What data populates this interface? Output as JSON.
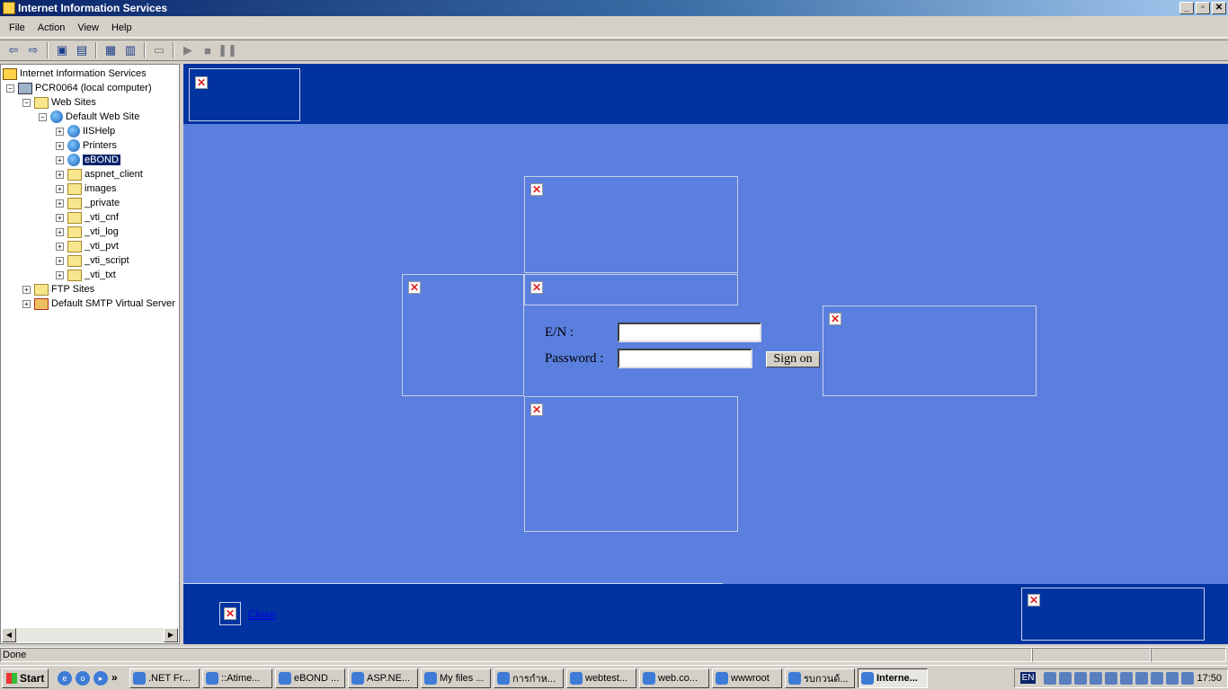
{
  "window": {
    "title": "Internet Information Services",
    "min": "_",
    "restore": "▫",
    "close": "✕"
  },
  "menu": [
    "File",
    "Action",
    "View",
    "Help"
  ],
  "toolbar": {
    "buttons": [
      "back-icon",
      "forward-icon",
      "up-icon",
      "show-hide-tree-icon",
      "properties-icon",
      "export-icon",
      "computer-icon",
      "play-icon",
      "stop-icon",
      "pause-icon"
    ]
  },
  "tree": {
    "root": "Internet Information Services",
    "computer": "PCR0064 (local computer)",
    "web_sites": "Web Sites",
    "default_web_site": "Default Web Site",
    "children": [
      "IISHelp",
      "Printers",
      "eBOND",
      "aspnet_client",
      "images",
      "_private",
      "_vti_cnf",
      "_vti_log",
      "_vti_pvt",
      "_vti_script",
      "_vti_txt"
    ],
    "ftp_sites": "FTP Sites",
    "smtp": "Default SMTP Virtual Server",
    "selected": "eBOND"
  },
  "page": {
    "en_label": "E/N :",
    "password_label": "Password :",
    "en_value": "",
    "password_value": "",
    "signon": "Sign on",
    "close_link": "Close",
    "broken_image": "✕"
  },
  "status": {
    "text": "Done"
  },
  "taskbar": {
    "start": "Start",
    "chevron": "»",
    "tasks": [
      ".NET Fr...",
      "::Atime...",
      "eBOND ...",
      "ASP.NE...",
      "My files ...",
      "การกำห...",
      "webtest...",
      "web.co...",
      "wwwroot",
      "รบกวนด้...",
      "Interne..."
    ],
    "lang": "EN",
    "clock": "17:50"
  },
  "colors": {
    "page_blue": "#5b7fde",
    "header_blue": "#0033a0",
    "selection": "#0a246a"
  }
}
